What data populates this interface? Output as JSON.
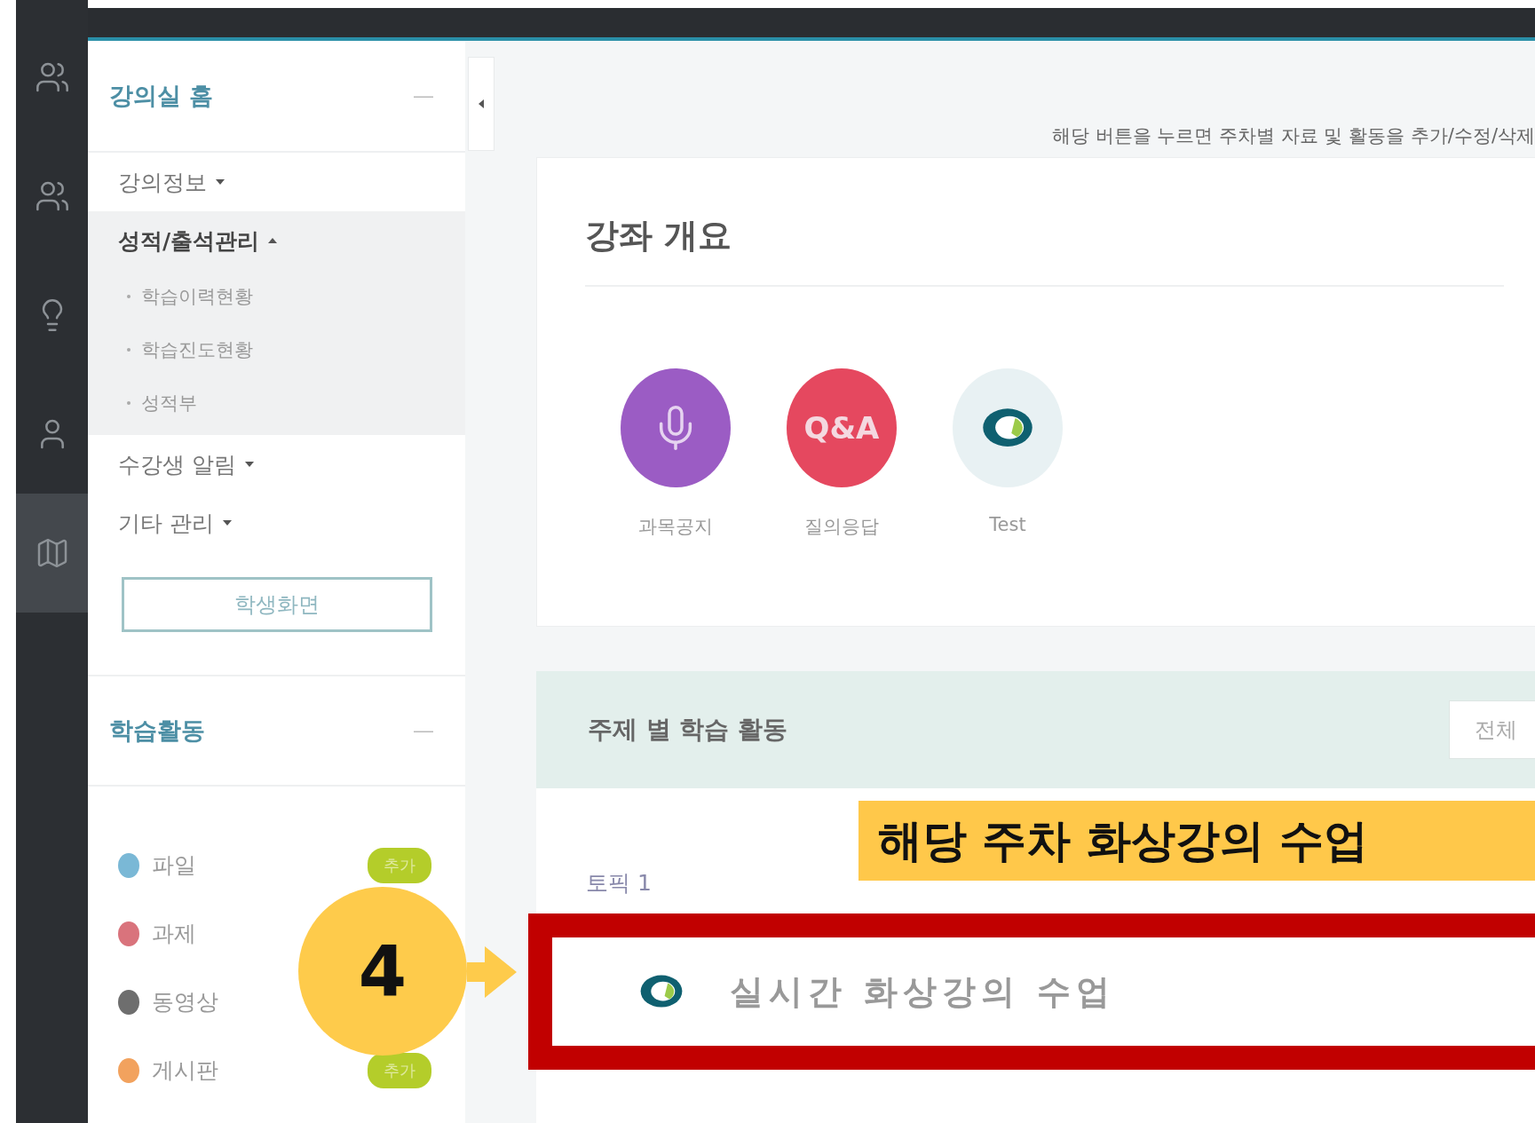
{
  "rail": {
    "items": [
      {
        "kind": "group",
        "selected": false
      },
      {
        "kind": "group",
        "selected": false
      },
      {
        "kind": "bulb",
        "selected": false
      },
      {
        "kind": "user",
        "selected": false
      },
      {
        "kind": "map",
        "selected": true
      }
    ]
  },
  "sidebar": {
    "home_panel": {
      "title": "강의실 홈",
      "collapse": "—",
      "menu": [
        {
          "label": "강의정보",
          "expanded": false
        },
        {
          "label": "성적/출석관리",
          "expanded": true,
          "children": [
            {
              "label": "학습이력현황"
            },
            {
              "label": "학습진도현황"
            },
            {
              "label": "성적부"
            }
          ]
        },
        {
          "label": "수강생 알림",
          "expanded": false
        },
        {
          "label": "기타 관리",
          "expanded": false
        }
      ],
      "student_view_button": "학생화면"
    },
    "activity_panel": {
      "title": "학습활동",
      "collapse": "—",
      "items": [
        {
          "label": "파일",
          "color": "#7ab8d6",
          "badge": "추가"
        },
        {
          "label": "과제",
          "color": "#d9737c"
        },
        {
          "label": "동영상",
          "color": "#6e6e6e"
        },
        {
          "label": "게시판",
          "color": "#f2a25e",
          "badge": "추가"
        }
      ]
    }
  },
  "main": {
    "hint": "해당 버튼을 누르면 주차별 자료 및 활동을 추가/수정/삭제",
    "overview": {
      "title": "강좌 개요",
      "shortcuts": [
        {
          "kind": "mic",
          "label": "과목공지",
          "color": "#9b5cc4"
        },
        {
          "kind": "text",
          "icon_text": "Q&A",
          "label": "질의응답",
          "color": "#e5485f"
        },
        {
          "kind": "ring",
          "label": "Test",
          "color": "#e8f1f3"
        }
      ]
    },
    "topics": {
      "title": "주제 별 학습 활동",
      "filter_button": "전체",
      "topic": {
        "title": "토픽 1",
        "activities": [
          {
            "title": "실시간 화상강의 수업",
            "highlighted": true
          }
        ]
      }
    }
  },
  "annotations": {
    "callout": "해당 주차 화상강의 수업",
    "step": "4"
  }
}
